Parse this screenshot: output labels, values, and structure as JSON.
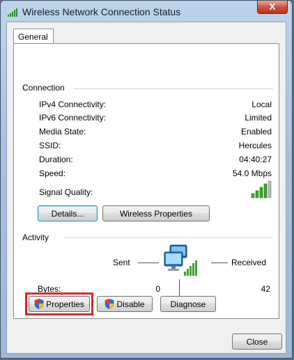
{
  "window": {
    "title": "Wireless Network Connection Status",
    "close_glyph": "X"
  },
  "tabs": [
    {
      "label": "General"
    }
  ],
  "connection": {
    "group_label": "Connection",
    "rows": [
      {
        "label": "IPv4 Connectivity:",
        "value": "Local"
      },
      {
        "label": "IPv6 Connectivity:",
        "value": "Limited"
      },
      {
        "label": "Media State:",
        "value": "Enabled"
      },
      {
        "label": "SSID:",
        "value": "Hercules"
      },
      {
        "label": "Duration:",
        "value": "04:40:27"
      },
      {
        "label": "Speed:",
        "value": "54.0 Mbps"
      }
    ],
    "signal_label": "Signal Quality:",
    "signal_icon": "signal-bars-icon",
    "details_button": "Details...",
    "wireless_properties_button": "Wireless Properties"
  },
  "activity": {
    "group_label": "Activity",
    "sent_label": "Sent",
    "received_label": "Received",
    "bytes_label": "Bytes:",
    "bytes_sent": "0",
    "bytes_received": "42"
  },
  "actions": {
    "properties": "Properties",
    "disable": "Disable",
    "diagnose": "Diagnose"
  },
  "footer": {
    "close": "Close"
  },
  "colors": {
    "highlight": "#d22b2b",
    "signal": "#3aa52a"
  }
}
